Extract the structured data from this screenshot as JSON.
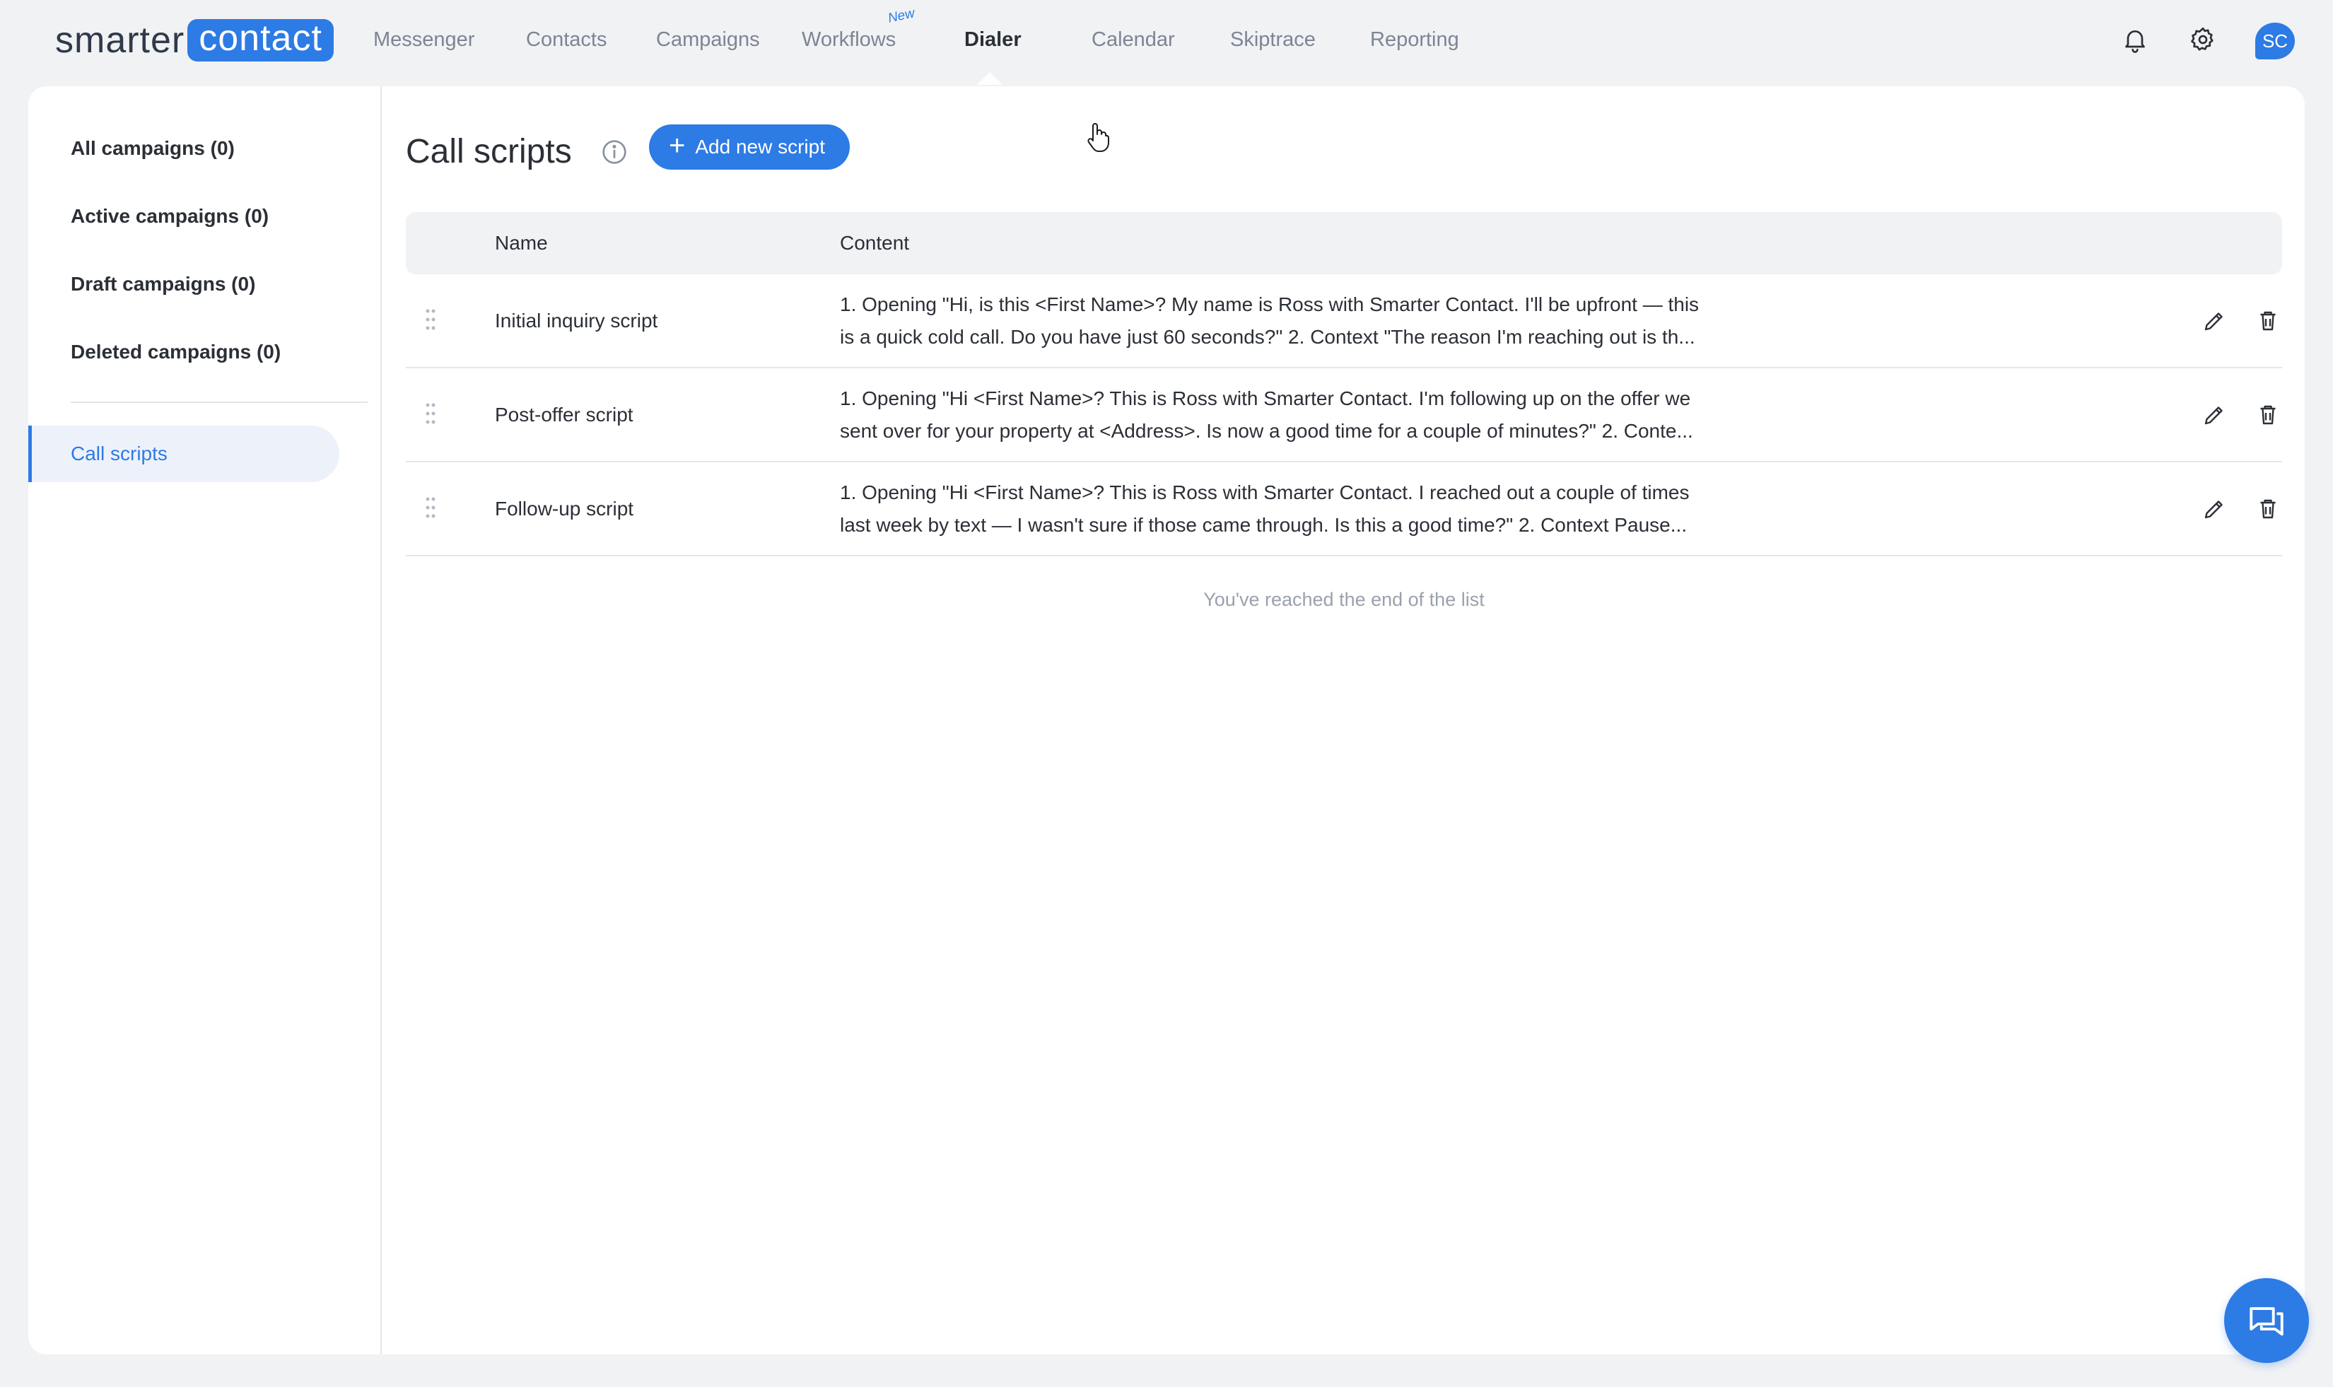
{
  "brand": {
    "part1": "smarter",
    "part2": "contact",
    "accent": "#2d7be5"
  },
  "nav": {
    "items": [
      "Messenger",
      "Contacts",
      "Campaigns",
      "Workflows",
      "Dialer",
      "Calendar",
      "Skiptrace",
      "Reporting"
    ],
    "new_badge": "New",
    "active": "Dialer"
  },
  "header_icons": {
    "notifications": "bell-icon",
    "settings": "gear-icon",
    "avatar_initials": "SC"
  },
  "sidebar": {
    "items": [
      "All campaigns (0)",
      "Active campaigns (0)",
      "Draft campaigns (0)",
      "Deleted campaigns (0)"
    ],
    "active_item": "Call scripts"
  },
  "page": {
    "title": "Call scripts",
    "add_button": "Add new script"
  },
  "table": {
    "headers": {
      "name": "Name",
      "content": "Content"
    },
    "rows": [
      {
        "name": "Initial inquiry script",
        "line1": "1. Opening \"Hi, is this <First Name>? My name is Ross with Smarter Contact. I'll be upfront — this",
        "line2": "is a quick cold call. Do you have just 60 seconds?\" 2. Context \"The reason I'm reaching out is th..."
      },
      {
        "name": "Post-offer script",
        "line1": "1. Opening \"Hi <First Name>? This is Ross with Smarter Contact. I'm following up on the offer we",
        "line2": "sent over for your property at <Address>. Is now a good time for a couple of minutes?\" 2. Conte..."
      },
      {
        "name": "Follow-up script",
        "line1": "1. Opening \"Hi <First Name>? This is Ross with Smarter Contact. I reached out a couple of times",
        "line2": "last week by text — I wasn't sure if those came through. Is this a good time?\" 2. Context Pause..."
      }
    ],
    "end_note": "You've reached the end of the list"
  }
}
